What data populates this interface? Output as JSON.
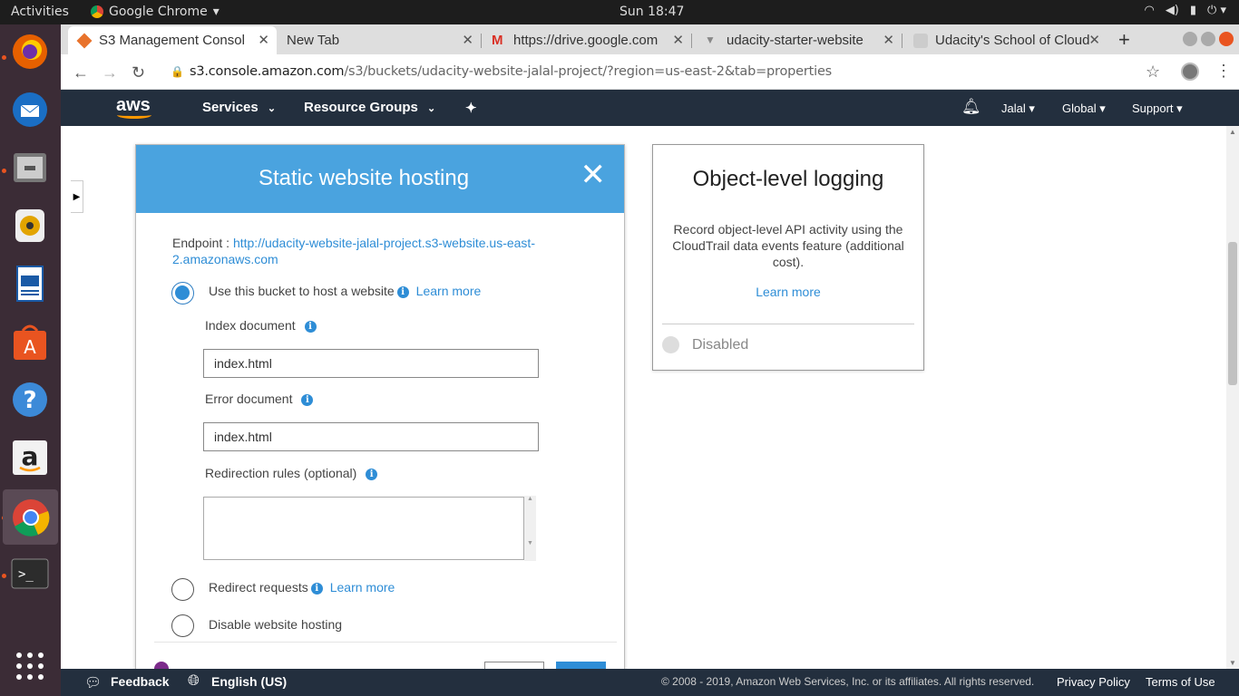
{
  "topbar": {
    "activities": "Activities",
    "app": "Google Chrome",
    "clock": "Sun 18:47"
  },
  "tabs": [
    {
      "title": "S3 Management Console",
      "active": true
    },
    {
      "title": "New Tab"
    },
    {
      "title": "https://drive.google.com"
    },
    {
      "title": "udacity-starter-website"
    },
    {
      "title": "Udacity's School of Cloud"
    }
  ],
  "address": {
    "host": "s3.console.amazon.com",
    "path": "/s3/buckets/udacity-website-jalal-project/?region=us-east-2&tab=properties"
  },
  "awsnav": {
    "logo": "aws",
    "services": "Services",
    "resource_groups": "Resource Groups",
    "user": "Jalal",
    "region": "Global",
    "support": "Support"
  },
  "modal": {
    "title": "Static website hosting",
    "endpoint_label": "Endpoint :",
    "endpoint_url": "http://udacity-website-jalal-project.s3-website.us-east-2.amazonaws.com",
    "use_bucket": "Use this bucket to host a website",
    "learn_more": "Learn more",
    "index_label": "Index document",
    "index_value": "index.html",
    "error_label": "Error document",
    "error_value": "index.html",
    "redirection_label": "Redirection rules (optional)",
    "redirect_requests": "Redirect requests",
    "disable_hosting": "Disable website hosting",
    "selected_option": "use_bucket"
  },
  "logging_card": {
    "title": "Object-level logging",
    "description": "Record object-level API activity using the CloudTrail data events feature (additional cost).",
    "learn_more": "Learn more",
    "status": "Disabled"
  },
  "footer": {
    "feedback": "Feedback",
    "language": "English (US)",
    "copyright": "© 2008 - 2019, Amazon Web Services, Inc. or its affiliates. All rights reserved.",
    "privacy": "Privacy Policy",
    "terms": "Terms of Use"
  }
}
